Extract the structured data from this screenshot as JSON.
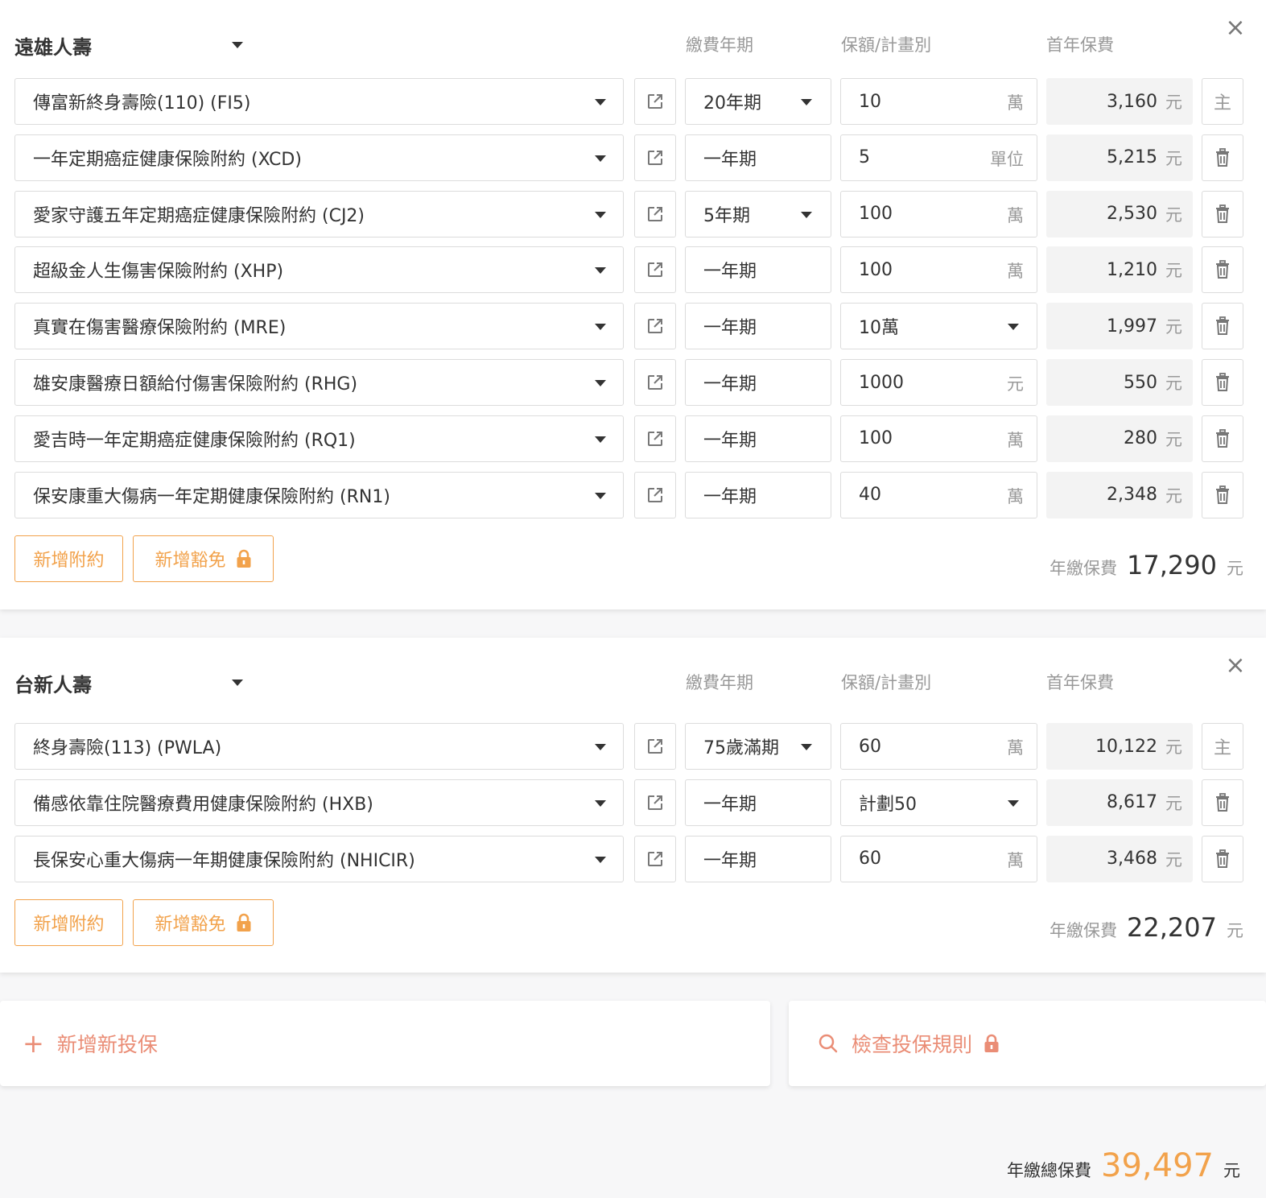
{
  "groups": [
    {
      "company": "遠雄人壽",
      "headers": {
        "term": "繳費年期",
        "amount": "保額/計畫別",
        "premium": "首年保費"
      },
      "rows": [
        {
          "plan": "傳富新終身壽險(110) (FI5)",
          "term": "20年期",
          "term_dropdown": true,
          "amount": "10",
          "amount_unit": "萬",
          "amount_dropdown": false,
          "premium": "3,160",
          "premium_unit": "元",
          "action": "主"
        },
        {
          "plan": "一年定期癌症健康保險附約 (XCD)",
          "term": "一年期",
          "term_dropdown": false,
          "amount": "5",
          "amount_unit": "單位",
          "amount_dropdown": false,
          "premium": "5,215",
          "premium_unit": "元",
          "action": "trash"
        },
        {
          "plan": "愛家守護五年定期癌症健康保險附約 (CJ2)",
          "term": "5年期",
          "term_dropdown": true,
          "amount": "100",
          "amount_unit": "萬",
          "amount_dropdown": false,
          "premium": "2,530",
          "premium_unit": "元",
          "action": "trash"
        },
        {
          "plan": "超級金人生傷害保險附約 (XHP)",
          "term": "一年期",
          "term_dropdown": false,
          "amount": "100",
          "amount_unit": "萬",
          "amount_dropdown": false,
          "premium": "1,210",
          "premium_unit": "元",
          "action": "trash"
        },
        {
          "plan": "真實在傷害醫療保險附約 (MRE)",
          "term": "一年期",
          "term_dropdown": false,
          "amount": "10萬",
          "amount_unit": "",
          "amount_dropdown": true,
          "premium": "1,997",
          "premium_unit": "元",
          "action": "trash"
        },
        {
          "plan": "雄安康醫療日額給付傷害保險附約 (RHG)",
          "term": "一年期",
          "term_dropdown": false,
          "amount": "1000",
          "amount_unit": "元",
          "amount_dropdown": false,
          "premium": "550",
          "premium_unit": "元",
          "action": "trash"
        },
        {
          "plan": "愛吉時一年定期癌症健康保險附約 (RQ1)",
          "term": "一年期",
          "term_dropdown": false,
          "amount": "100",
          "amount_unit": "萬",
          "amount_dropdown": false,
          "premium": "280",
          "premium_unit": "元",
          "action": "trash"
        },
        {
          "plan": "保安康重大傷病一年定期健康保險附約 (RN1)",
          "term": "一年期",
          "term_dropdown": false,
          "amount": "40",
          "amount_unit": "萬",
          "amount_dropdown": false,
          "premium": "2,348",
          "premium_unit": "元",
          "action": "trash"
        }
      ],
      "buttons": {
        "add_rider": "新增附約",
        "add_waiver": "新增豁免"
      },
      "total": {
        "label": "年繳保費",
        "value": "17,290",
        "unit": "元"
      }
    },
    {
      "company": "台新人壽",
      "headers": {
        "term": "繳費年期",
        "amount": "保額/計畫別",
        "premium": "首年保費"
      },
      "rows": [
        {
          "plan": "終身壽險(113) (PWLA)",
          "term": "75歲滿期",
          "term_dropdown": true,
          "amount": "60",
          "amount_unit": "萬",
          "amount_dropdown": false,
          "premium": "10,122",
          "premium_unit": "元",
          "action": "主"
        },
        {
          "plan": "備感依靠住院醫療費用健康保險附約 (HXB)",
          "term": "一年期",
          "term_dropdown": false,
          "amount": "計劃50",
          "amount_unit": "",
          "amount_dropdown": true,
          "premium": "8,617",
          "premium_unit": "元",
          "action": "trash"
        },
        {
          "plan": "長保安心重大傷病一年期健康保險附約 (NHICIR)",
          "term": "一年期",
          "term_dropdown": false,
          "amount": "60",
          "amount_unit": "萬",
          "amount_dropdown": false,
          "premium": "3,468",
          "premium_unit": "元",
          "action": "trash"
        }
      ],
      "buttons": {
        "add_rider": "新增附約",
        "add_waiver": "新增豁免"
      },
      "total": {
        "label": "年繳保費",
        "value": "22,207",
        "unit": "元"
      }
    }
  ],
  "actions": {
    "add_policy": "新增新投保",
    "check_rules": "檢查投保規則"
  },
  "grand_total": {
    "label": "年繳總保費",
    "value": "39,497",
    "unit": "元"
  },
  "colors": {
    "accent": "#f2a24b",
    "action_text": "#ea8d76"
  },
  "icons": {
    "close": "close-icon",
    "edit": "external-edit-icon",
    "delete": "trash-icon",
    "lock": "lock-icon",
    "search": "search-icon",
    "plus": "plus-icon"
  }
}
